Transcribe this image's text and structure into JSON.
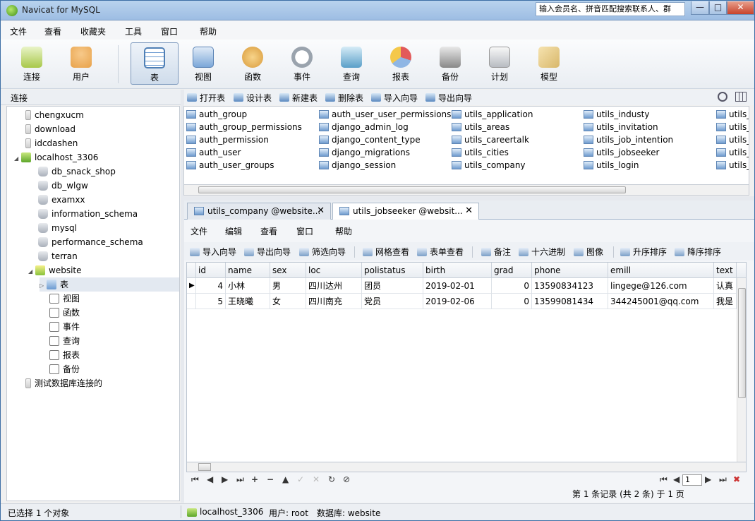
{
  "window": {
    "title": "Navicat for MySQL",
    "search_text": "输入会员名、拼音匹配搜索联系人、群",
    "min": "—",
    "max": "□",
    "close": "✕"
  },
  "menu": [
    "文件",
    "查看",
    "收藏夹",
    "工具",
    "窗口",
    "帮助"
  ],
  "toolbar": [
    {
      "label": "连接",
      "icon": "connect-plug-icon",
      "color": "#a8c84a"
    },
    {
      "label": "用户",
      "icon": "user-icon",
      "color": "#e8a24a"
    },
    {
      "label": "表",
      "icon": "table-icon",
      "color": "#6a9ad1"
    },
    {
      "label": "视图",
      "icon": "view-icon",
      "color": "#7ba7d8"
    },
    {
      "label": "函数",
      "icon": "function-icon",
      "color": "#d99a3a"
    },
    {
      "label": "事件",
      "icon": "event-clock-icon",
      "color": "#9aa3ad"
    },
    {
      "label": "查询",
      "icon": "query-icon",
      "color": "#5a9fc8"
    },
    {
      "label": "报表",
      "icon": "report-icon",
      "color": "#8fb6e4"
    },
    {
      "label": "备份",
      "icon": "backup-icon",
      "color": "#888888"
    },
    {
      "label": "计划",
      "icon": "schedule-icon",
      "color": "#b8bcc2"
    },
    {
      "label": "模型",
      "icon": "model-icon",
      "color": "#d8b76a"
    }
  ],
  "left": {
    "header": "连接",
    "tree": [
      {
        "label": "chengxucm",
        "icon": "conn"
      },
      {
        "label": "download",
        "icon": "conn"
      },
      {
        "label": "idcdashen",
        "icon": "conn"
      },
      {
        "label": "localhost_3306",
        "icon": "srv",
        "toggle": "◢"
      },
      {
        "label": "db_snack_shop",
        "icon": "db"
      },
      {
        "label": "db_wlgw",
        "icon": "db"
      },
      {
        "label": "examxx",
        "icon": "db"
      },
      {
        "label": "information_schema",
        "icon": "db"
      },
      {
        "label": "mysql",
        "icon": "db"
      },
      {
        "label": "performance_schema",
        "icon": "db"
      },
      {
        "label": "terran",
        "icon": "db"
      },
      {
        "label": "website",
        "icon": "web",
        "toggle": "◢"
      },
      {
        "label": "表",
        "icon": "tbl",
        "toggle": "▷",
        "selected": true
      },
      {
        "label": "视图",
        "icon": "sm"
      },
      {
        "label": "函数",
        "icon": "sm"
      },
      {
        "label": "事件",
        "icon": "sm"
      },
      {
        "label": "查询",
        "icon": "sm"
      },
      {
        "label": "报表",
        "icon": "sm"
      },
      {
        "label": "备份",
        "icon": "sm"
      },
      {
        "label": "测试数据库连接的",
        "icon": "conn"
      }
    ]
  },
  "objbar": [
    "打开表",
    "设计表",
    "新建表",
    "删除表",
    "导入向导",
    "导出向导"
  ],
  "objects": [
    [
      "auth_group",
      "auth_group_permissions",
      "auth_permission",
      "auth_user",
      "auth_user_groups"
    ],
    [
      "auth_user_user_permissions",
      "django_admin_log",
      "django_content_type",
      "django_migrations",
      "django_session"
    ],
    [
      "utils_application",
      "utils_areas",
      "utils_careertalk",
      "utils_cities",
      "utils_company"
    ],
    [
      "utils_industy",
      "utils_invitation",
      "utils_job_intention",
      "utils_jobseeker",
      "utils_login"
    ],
    [
      "utils_",
      "utils_",
      "utils_",
      "utils_",
      "utils_"
    ]
  ],
  "tabs": [
    {
      "label": "utils_company @website...",
      "close": "✕"
    },
    {
      "label": "utils_jobseeker @websit...",
      "close": "✕"
    }
  ],
  "inner_menu": [
    "文件",
    "编辑",
    "查看",
    "窗口",
    "帮助"
  ],
  "gridbar": [
    "导入向导",
    "导出向导",
    "筛选向导",
    "网格查看",
    "表单查看",
    "备注",
    "十六进制",
    "图像",
    "升序排序",
    "降序排序"
  ],
  "grid": {
    "columns": [
      "id",
      "name",
      "sex",
      "loc",
      "polistatus",
      "birth",
      "grad",
      "phone",
      "emill",
      "text"
    ],
    "rows": [
      [
        "4",
        "小林",
        "男",
        "四川达州",
        "团员",
        "2019-02-01",
        "0",
        "13590834123",
        "lingege@126.com",
        "认真"
      ],
      [
        "5",
        "王晓曦",
        "女",
        "四川南充",
        "党员",
        "2019-02-06",
        "0",
        "13599081434",
        "344245001@qq.com",
        "我是"
      ]
    ],
    "row_marker": "▶"
  },
  "nav": {
    "buttons": [
      "⏮",
      "◀",
      "▶",
      "⏭",
      "+",
      "−",
      "▲",
      "✓",
      "✕",
      "↻",
      "⊘"
    ],
    "page": "1",
    "right": [
      "⏮",
      "◀",
      "▶",
      "⏭",
      "✖"
    ],
    "record_info": "第 1 条记录 (共 2 条) 于 1 页"
  },
  "status": {
    "left": "已选择 1 个对象",
    "conn": "localhost_3306",
    "user": "用户: root",
    "db": "数据库: website"
  }
}
